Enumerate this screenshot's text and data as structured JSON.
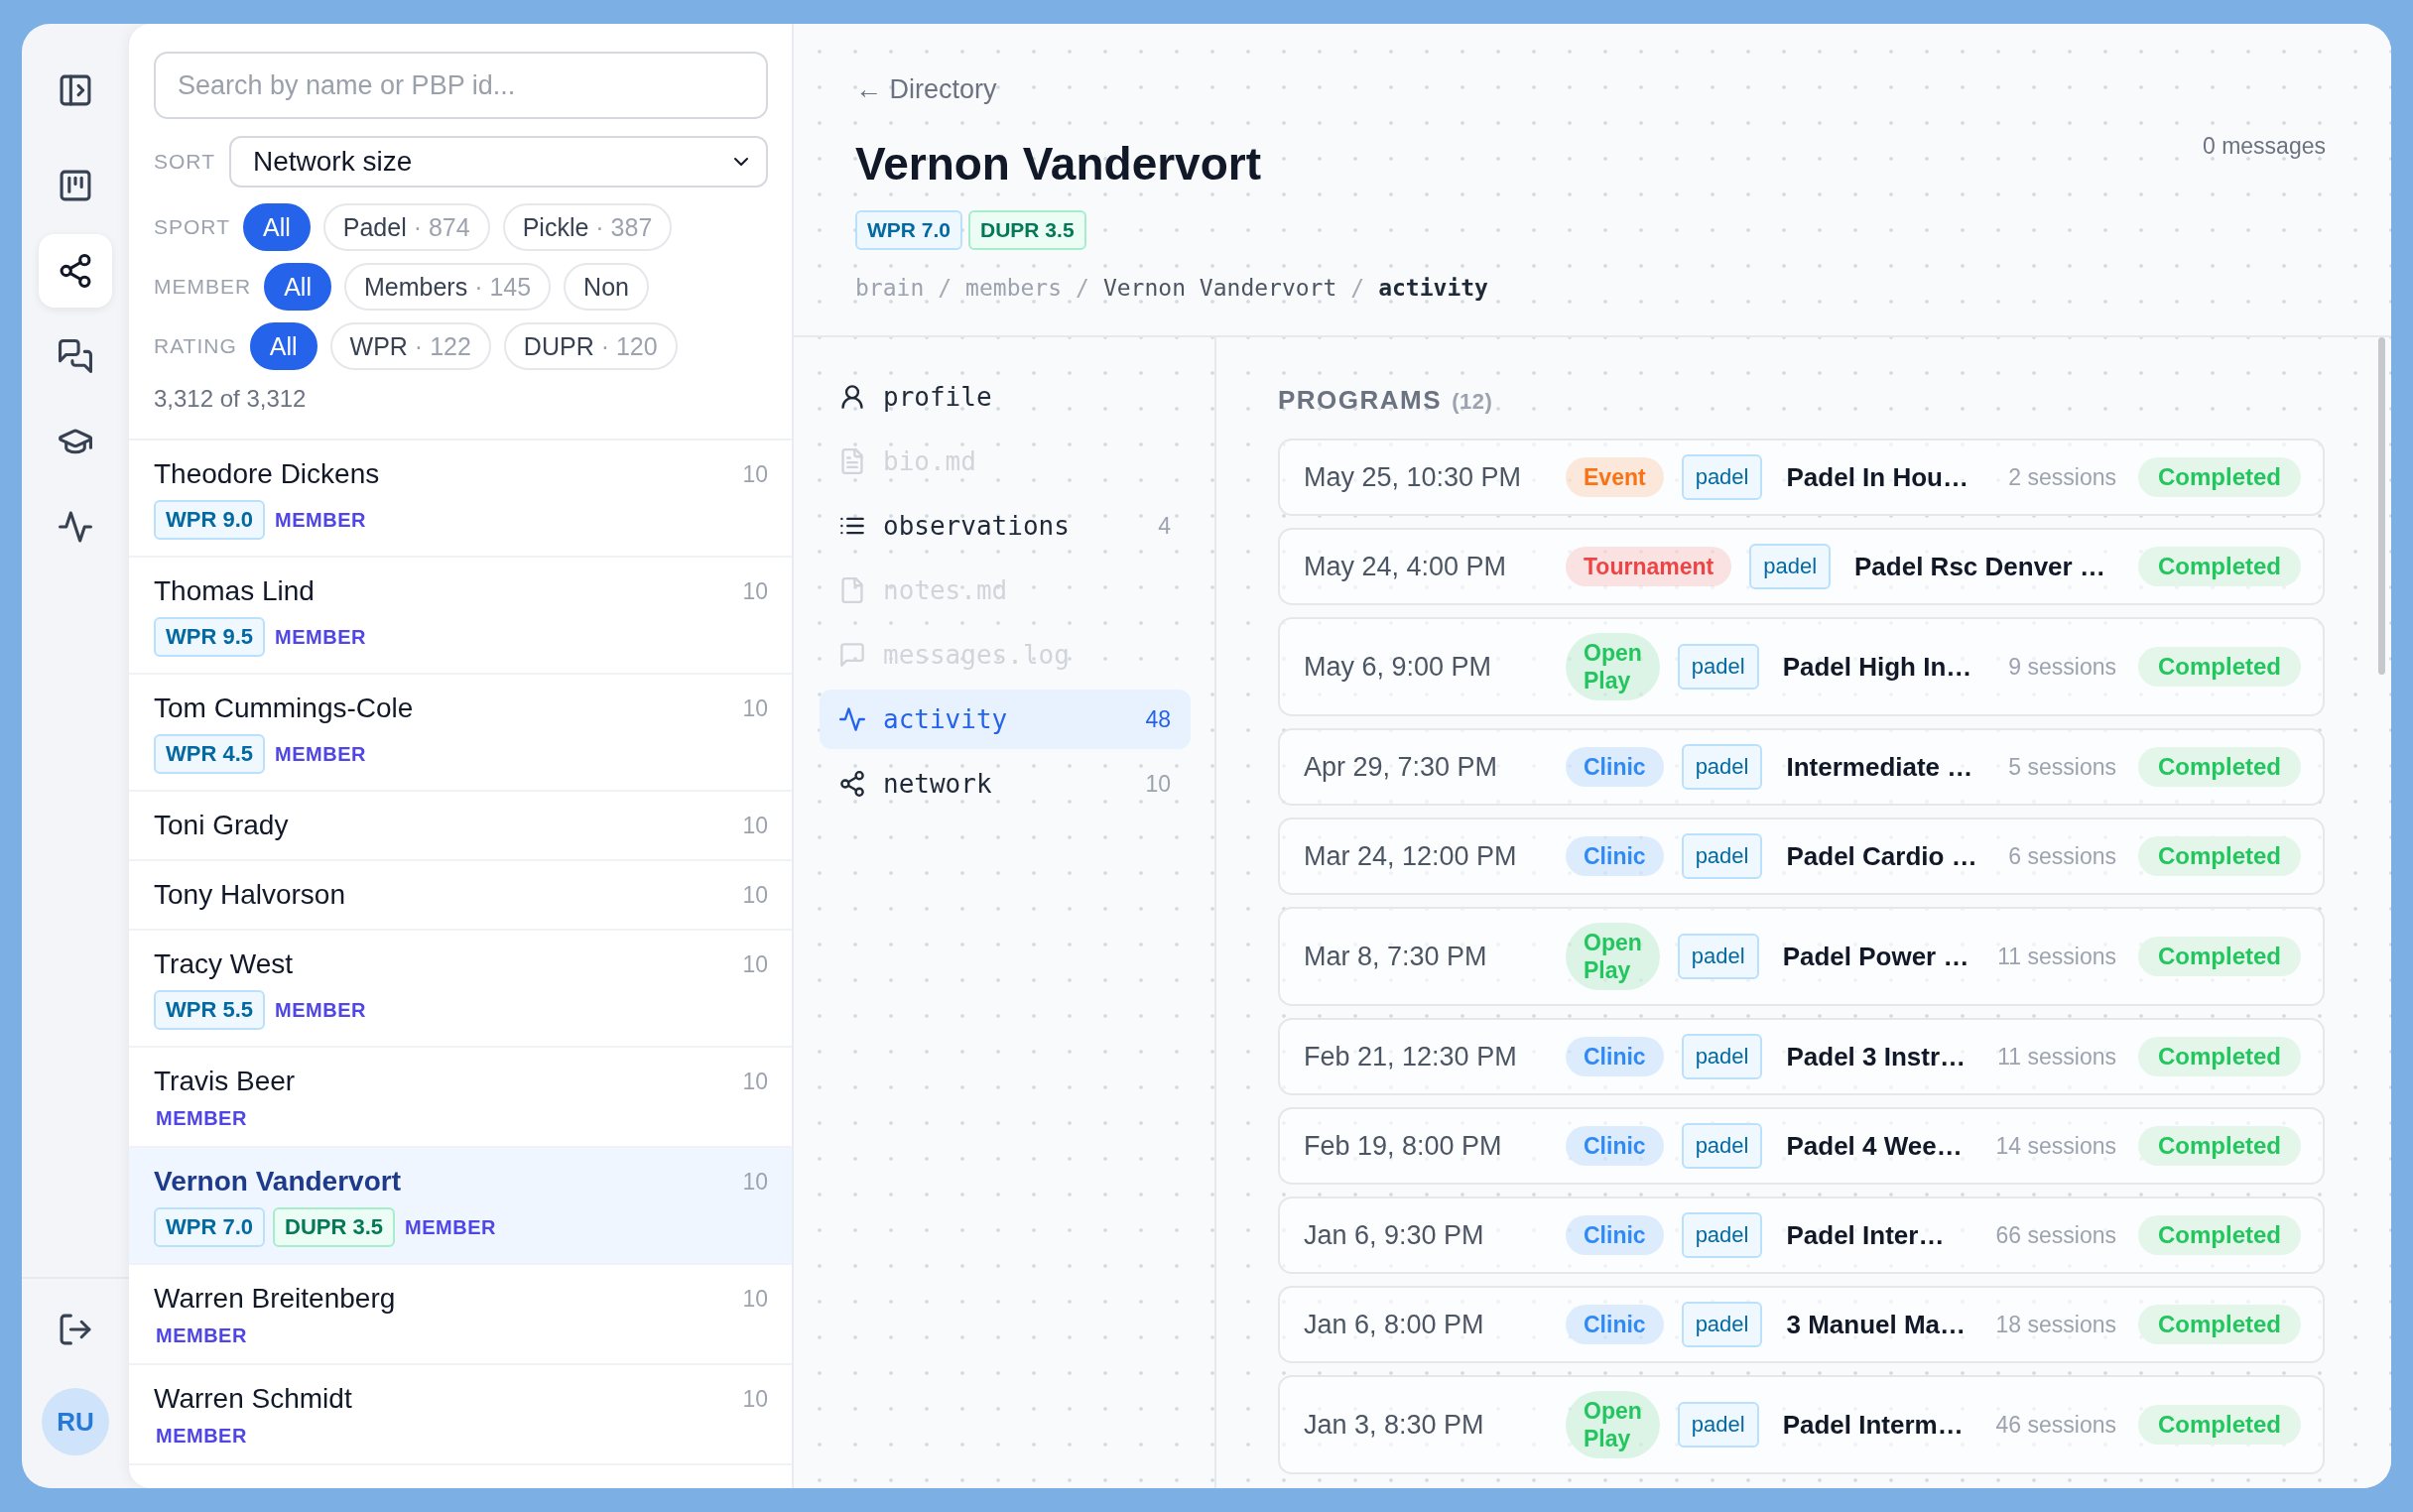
{
  "rail": {
    "items": [
      {
        "kind": "panel",
        "selected": false
      },
      {
        "kind": "board",
        "selected": false
      },
      {
        "kind": "share",
        "selected": true
      },
      {
        "kind": "chat",
        "selected": false
      },
      {
        "kind": "cap",
        "selected": false
      },
      {
        "kind": "pulse",
        "selected": false
      }
    ],
    "avatar": {
      "initials": "RU"
    }
  },
  "directory": {
    "search": {
      "placeholder": "Search by name or PBP id..."
    },
    "sort": {
      "label": "SORT",
      "value": "Network size"
    },
    "filters": [
      {
        "label": "SPORT",
        "chips": [
          {
            "label": "All",
            "selected": true
          },
          {
            "label": "Padel",
            "count": "· 874",
            "selected": false
          },
          {
            "label": "Pickle",
            "count": "· 387",
            "selected": false
          }
        ]
      },
      {
        "label": "MEMBER",
        "chips": [
          {
            "label": "All",
            "selected": true
          },
          {
            "label": "Members",
            "count": "· 145",
            "selected": false
          },
          {
            "label": "Non",
            "selected": false
          }
        ]
      },
      {
        "label": "RATING",
        "chips": [
          {
            "label": "All",
            "selected": true
          },
          {
            "label": "WPR",
            "count": "· 122",
            "selected": false
          },
          {
            "label": "DUPR",
            "count": "· 120",
            "selected": false
          }
        ]
      }
    ],
    "result_count": "3,312 of 3,312",
    "members": [
      {
        "name": "Theodore Dickens",
        "count": "10",
        "selected": false,
        "badges": [
          {
            "kind": "wpr",
            "label": "WPR 9.0"
          },
          {
            "kind": "member",
            "label": "MEMBER"
          }
        ]
      },
      {
        "name": "Thomas Lind",
        "count": "10",
        "selected": false,
        "badges": [
          {
            "kind": "wpr",
            "label": "WPR 9.5"
          },
          {
            "kind": "member",
            "label": "MEMBER"
          }
        ]
      },
      {
        "name": "Tom Cummings-Cole",
        "count": "10",
        "selected": false,
        "badges": [
          {
            "kind": "wpr",
            "label": "WPR 4.5"
          },
          {
            "kind": "member",
            "label": "MEMBER"
          }
        ]
      },
      {
        "name": "Toni Grady",
        "count": "10",
        "selected": false
      },
      {
        "name": "Tony Halvorson",
        "count": "10",
        "selected": false
      },
      {
        "name": "Tracy West",
        "count": "10",
        "selected": false,
        "badges": [
          {
            "kind": "wpr",
            "label": "WPR 5.5"
          },
          {
            "kind": "member",
            "label": "MEMBER"
          }
        ]
      },
      {
        "name": "Travis Beer",
        "count": "10",
        "selected": false,
        "badges": [
          {
            "kind": "member",
            "label": "MEMBER"
          }
        ]
      },
      {
        "name": "Vernon Vandervort",
        "count": "10",
        "selected": true,
        "badges": [
          {
            "kind": "wpr",
            "label": "WPR 7.0"
          },
          {
            "kind": "dupr",
            "label": "DUPR 3.5"
          },
          {
            "kind": "member",
            "label": "MEMBER"
          }
        ]
      },
      {
        "name": "Warren Breitenberg",
        "count": "10",
        "selected": false,
        "badges": [
          {
            "kind": "member",
            "label": "MEMBER"
          }
        ]
      },
      {
        "name": "Warren Schmidt",
        "count": "10",
        "selected": false,
        "badges": [
          {
            "kind": "member",
            "label": "MEMBER"
          }
        ]
      }
    ]
  },
  "detail": {
    "back_link": "← Directory",
    "name": "Vernon Vandervort",
    "messages": "0 messages",
    "badges": [
      {
        "kind": "wpr",
        "label": "WPR 7.0"
      },
      {
        "kind": "dupr",
        "label": "DUPR 3.5"
      }
    ],
    "breadcrumb": [
      {
        "kind": "path",
        "label": "brain"
      },
      {
        "kind": "separator",
        "label": "/"
      },
      {
        "kind": "path",
        "label": "members"
      },
      {
        "kind": "separator",
        "label": "/"
      },
      {
        "kind": "entity",
        "label": "Vernon Vandervort"
      },
      {
        "kind": "separator",
        "label": "/"
      },
      {
        "kind": "current",
        "label": "activity"
      }
    ],
    "nav": [
      {
        "kind": "person",
        "label": "profile",
        "selected": false,
        "disabled": false
      },
      {
        "kind": "document",
        "label": "bio.md",
        "selected": false,
        "disabled": true
      },
      {
        "kind": "list",
        "label": "observations",
        "count": "4",
        "selected": false,
        "disabled": false
      },
      {
        "kind": "file",
        "label": "notes.md",
        "selected": false,
        "disabled": true
      },
      {
        "kind": "bubble",
        "label": "messages.log",
        "selected": false,
        "disabled": true
      },
      {
        "kind": "pulse",
        "label": "activity",
        "count": "48",
        "selected": true,
        "disabled": false
      },
      {
        "kind": "share",
        "label": "network",
        "count": "10",
        "selected": false,
        "disabled": false
      }
    ],
    "programs": {
      "title": "PROGRAMS",
      "count": "(12)",
      "items": [
        {
          "date": "May 25, 10:30 PM",
          "type": {
            "label": "Event",
            "color": "#f97316"
          },
          "sport": "padel",
          "title": "Padel In Hou…",
          "sessions": "2 sessions",
          "status": "Completed"
        },
        {
          "date": "May 24, 4:00 PM",
          "type": {
            "label": "Tournament",
            "color": "#ef4444"
          },
          "sport": "padel",
          "title": "Padel Rsc Denver …",
          "status": "Completed"
        },
        {
          "date": "May 6, 9:00 PM",
          "type": {
            "label": "Open Play",
            "color": "#22c55e"
          },
          "sport": "padel",
          "title": "Padel High In…",
          "sessions": "9 sessions",
          "status": "Completed"
        },
        {
          "date": "Apr 29, 7:30 PM",
          "type": {
            "label": "Clinic",
            "color": "#2f8af5"
          },
          "sport": "padel",
          "title": "Intermediate …",
          "sessions": "5 sessions",
          "status": "Completed"
        },
        {
          "date": "Mar 24, 12:00 PM",
          "type": {
            "label": "Clinic",
            "color": "#2f8af5"
          },
          "sport": "padel",
          "title": "Padel Cardio …",
          "sessions": "6 sessions",
          "status": "Completed"
        },
        {
          "date": "Mar 8, 7:30 PM",
          "type": {
            "label": "Open Play",
            "color": "#22c55e"
          },
          "sport": "padel",
          "title": "Padel Power …",
          "sessions": "11 sessions",
          "status": "Completed"
        },
        {
          "date": "Feb 21, 12:30 PM",
          "type": {
            "label": "Clinic",
            "color": "#2f8af5"
          },
          "sport": "padel",
          "title": "Padel 3 Instr…",
          "sessions": "11 sessions",
          "status": "Completed"
        },
        {
          "date": "Feb 19, 8:00 PM",
          "type": {
            "label": "Clinic",
            "color": "#2f8af5"
          },
          "sport": "padel",
          "title": "Padel 4 Wee…",
          "sessions": "14 sessions",
          "status": "Completed"
        },
        {
          "date": "Jan 6, 9:30 PM",
          "type": {
            "label": "Clinic",
            "color": "#2f8af5"
          },
          "sport": "padel",
          "title": "Padel Inter…",
          "sessions": "66 sessions",
          "status": "Completed"
        },
        {
          "date": "Jan 6, 8:00 PM",
          "type": {
            "label": "Clinic",
            "color": "#2f8af5"
          },
          "sport": "padel",
          "title": "3 Manuel Ma…",
          "sessions": "18 sessions",
          "status": "Completed"
        },
        {
          "date": "Jan 3, 8:30 PM",
          "type": {
            "label": "Open Play",
            "color": "#22c55e"
          },
          "sport": "padel",
          "title": "Padel Interm…",
          "sessions": "46 sessions",
          "status": "Completed"
        }
      ]
    }
  }
}
